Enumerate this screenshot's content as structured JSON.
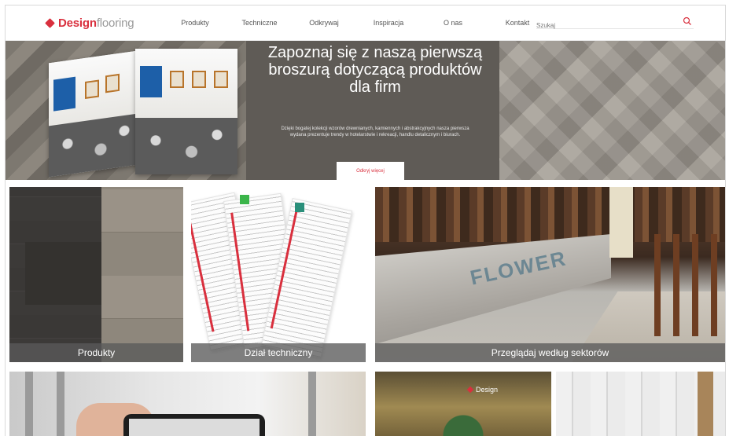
{
  "header": {
    "logo_primary": "Design",
    "logo_secondary": "flooring",
    "nav": [
      "Produkty",
      "Techniczne",
      "Odkrywaj",
      "Inspiracja",
      "O nas",
      "Kontakt"
    ],
    "search_placeholder": "Szukaj"
  },
  "hero": {
    "title": "Zapoznaj się z naszą pierwszą broszurą dotyczącą produktów dla firm",
    "description": "Dzięki bogatej kolekcji wzorów drewnianych, kamiennych i abstrakcyjnych nasza pierwsza wydana prezentuje trendy w hotelarstwie i rekreacji, handlu detalicznym i biurach.",
    "button_label": "Odkryj więcej"
  },
  "tiles": {
    "products": "Produkty",
    "technical": "Dział techniczny",
    "sectors": "Przeglądaj według sektorów"
  },
  "bar_sign": "FLOWER",
  "bottom_logo": "Design",
  "colors": {
    "brand_red": "#d9303e",
    "logo_grey": "#9a9a9a"
  }
}
